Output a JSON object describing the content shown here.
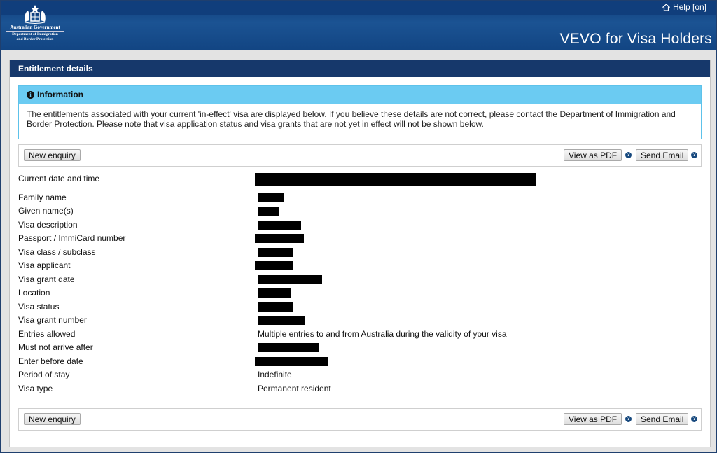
{
  "header": {
    "gov_line": "Australian Government",
    "dept_line1": "Department of Immigration",
    "dept_line2": "and Border Protection",
    "help_label": "Help [on]",
    "app_title": "VEVO for Visa Holders"
  },
  "panel": {
    "title": "Entitlement details",
    "info": {
      "title": "Information",
      "body": "The entitlements associated with your current 'in-effect' visa are displayed below. If you believe these details are not correct, please contact the Department of Immigration and Border Protection. Please note that visa application status and visa grants that are not yet in effect will not be shown below."
    },
    "buttons": {
      "new_enquiry": "New enquiry",
      "view_pdf": "View as PDF",
      "send_email": "Send Email",
      "help_glyph": "?"
    },
    "current_datetime_label": "Current date and time",
    "rows": [
      {
        "label": "Family name",
        "value": ""
      },
      {
        "label": "Given name(s)",
        "value": ""
      },
      {
        "label": "Visa description",
        "value": ""
      },
      {
        "label": "Passport / ImmiCard number",
        "value": ""
      },
      {
        "label": "Visa class / subclass",
        "value": ""
      },
      {
        "label": "Visa applicant",
        "value": ""
      },
      {
        "label": "Visa grant date",
        "value": ""
      },
      {
        "label": "Location",
        "value": ""
      },
      {
        "label": "Visa status",
        "value": ""
      },
      {
        "label": "Visa grant number",
        "value": ""
      },
      {
        "label": "Entries allowed",
        "value": "Multiple entries to and from Australia during the validity of your visa"
      },
      {
        "label": "Must not arrive after",
        "value": ""
      },
      {
        "label": "Enter before date",
        "value": ""
      },
      {
        "label": "Period of stay",
        "value": "Indefinite"
      },
      {
        "label": "Visa type",
        "value": "Permanent resident"
      }
    ]
  },
  "colors": {
    "header_blue": "#1b5393",
    "panel_head": "#16386b",
    "info_head": "#6bcbf2"
  },
  "icons": [
    "coat-of-arms-logo",
    "help-icon",
    "info-icon",
    "question-icon"
  ]
}
